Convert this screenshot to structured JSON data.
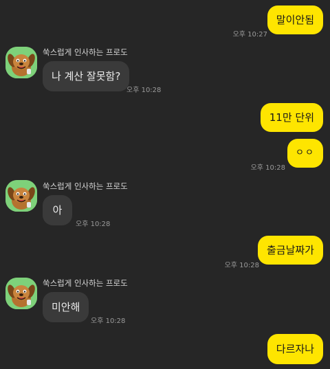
{
  "chat": {
    "sender_name": "쑥스럽게 인사하는 프로도",
    "messages": [
      {
        "from": "me",
        "text": "말이안됨",
        "time": "오후 10:27"
      },
      {
        "from": "other",
        "text": "나 계산 잘못함?",
        "time": "오후 10:28"
      },
      {
        "from": "me",
        "text": "11만 단위",
        "time": ""
      },
      {
        "from": "me",
        "text": "ㅇㅇ",
        "time": "오후 10:28"
      },
      {
        "from": "other",
        "text": "아",
        "time": "오후 10:28"
      },
      {
        "from": "me",
        "text": "출금날짜가",
        "time": "오후 10:28"
      },
      {
        "from": "other",
        "text": "미안해",
        "time": "오후 10:28"
      },
      {
        "from": "me",
        "text": "다르자나",
        "time": ""
      }
    ]
  },
  "icons": {
    "avatar": "frodo-dog-avatar-icon"
  },
  "colors": {
    "background": "#262626",
    "my_bubble": "#fee500",
    "other_bubble": "#3a3a3a",
    "avatar_bg": "#7ed17a"
  }
}
